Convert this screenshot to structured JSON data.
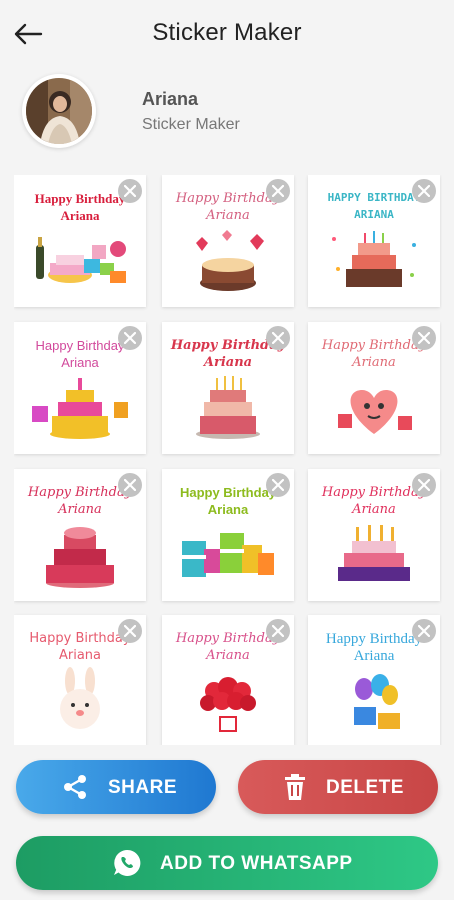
{
  "header": {
    "title": "Sticker Maker"
  },
  "profile": {
    "name": "Ariana",
    "subtitle": "Sticker Maker"
  },
  "stickers": [
    {
      "line1": "Happy Birthday",
      "line2": "Ariana",
      "color": "#d81e3c"
    },
    {
      "line1": "Happy Birthday",
      "line2": "Ariana",
      "color": "#d46080"
    },
    {
      "line1": "HAPPY BIRTHDAY",
      "line2": "ARIANA",
      "color": "#3bb6c6"
    },
    {
      "line1": "Happy Birthday",
      "line2": "Ariana",
      "color": "#d24a9c"
    },
    {
      "line1": "Happy Birthday",
      "line2": "Ariana",
      "color": "#d8364c"
    },
    {
      "line1": "Happy Birthday",
      "line2": "Ariana",
      "color": "#e06a74"
    },
    {
      "line1": "Happy Birthday",
      "line2": "Ariana",
      "color": "#d6305a"
    },
    {
      "line1": "Happy Birthday",
      "line2": "Ariana",
      "color": "#8dbb1e"
    },
    {
      "line1": "Happy Birthday",
      "line2": "Ariana",
      "color": "#e0305c"
    },
    {
      "line1": "Happy Birthday",
      "line2": "Ariana",
      "color": "#e65a6e"
    },
    {
      "line1": "Happy Birthday",
      "line2": "Ariana",
      "color": "#d8508a"
    },
    {
      "line1": "Happy Birthday",
      "line2": "Ariana",
      "color": "#38a8dc"
    }
  ],
  "actions": {
    "share_label": "SHARE",
    "delete_label": "DELETE",
    "whatsapp_label": "ADD TO WHATSAPP"
  },
  "icons": {
    "back": "arrow-left-icon",
    "close": "close-icon",
    "share": "share-icon",
    "delete": "trash-icon",
    "whatsapp": "whatsapp-icon"
  }
}
